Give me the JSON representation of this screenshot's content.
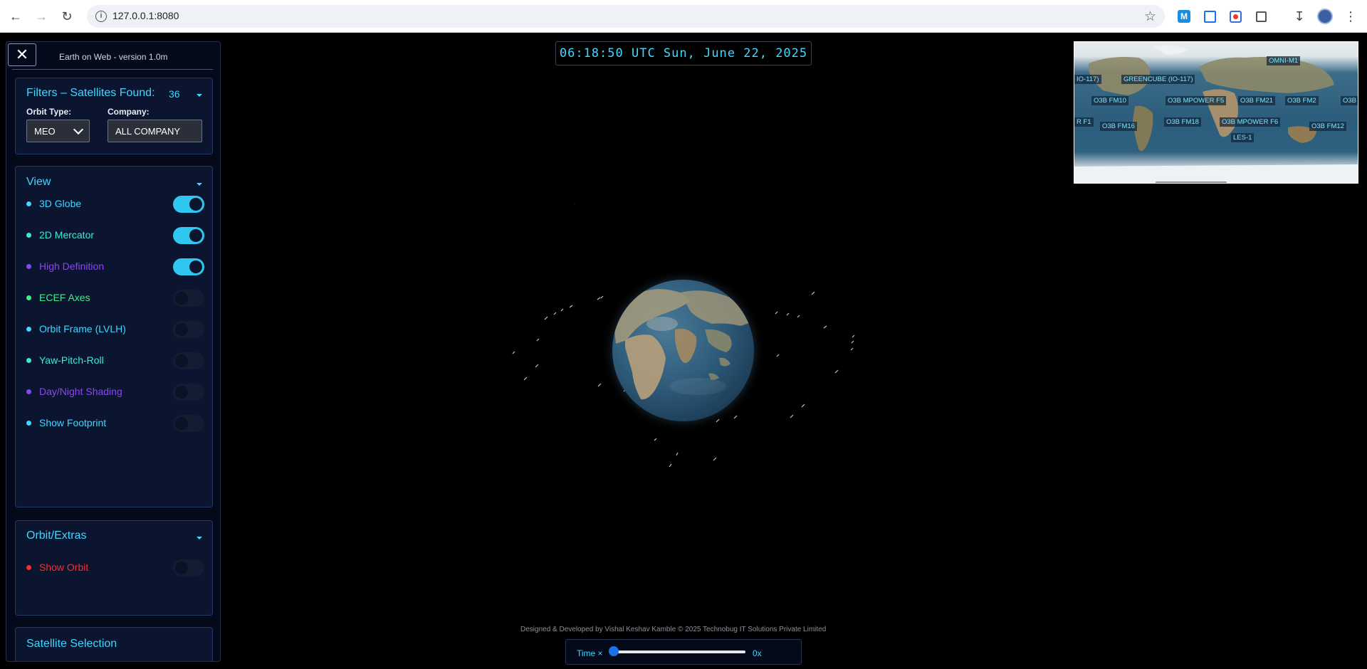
{
  "browser": {
    "url": "127.0.0.1:8080"
  },
  "app": {
    "version_label": "Earth on Web - version 1.0m",
    "clock": "06:18:50 UTC Sun, June 22, 2025",
    "credit": "Designed & Developed by Vishal Keshav Kamble   © 2025 Technobug IT Solutions Private Limited",
    "time_label": "Time ×",
    "time_value": "0x",
    "time_speed_fraction": 0
  },
  "filters": {
    "title": "Filters – Satellites Found:",
    "count": "36",
    "orbit_type_label": "Orbit Type:",
    "orbit_type_value": "MEO",
    "company_label": "Company:",
    "company_value": "ALL COMPANY"
  },
  "view": {
    "title": "View",
    "items": [
      {
        "label": "3D Globe",
        "on": true,
        "color": "#3fd6ff"
      },
      {
        "label": "2D Mercator",
        "on": true,
        "color": "#3fe9d8"
      },
      {
        "label": "High Definition",
        "on": true,
        "color": "#8a46f0"
      },
      {
        "label": "ECEF Axes",
        "on": false,
        "color": "#3ff08a"
      },
      {
        "label": "Orbit Frame (LVLH)",
        "on": false,
        "color": "#3fd6ff"
      },
      {
        "label": "Yaw-Pitch-Roll",
        "on": false,
        "color": "#3fe9d8"
      },
      {
        "label": "Day/Night Shading",
        "on": false,
        "color": "#8a46f0"
      },
      {
        "label": "Show Footprint",
        "on": false,
        "color": "#3fd6ff"
      }
    ]
  },
  "orbit_extras": {
    "title": "Orbit/Extras",
    "items": [
      {
        "label": "Show Orbit",
        "on": false,
        "color": "#ff2b2b"
      }
    ]
  },
  "satellite_selection": {
    "title": "Satellite Selection"
  },
  "minimap": {
    "labels": [
      "OMNI-M1",
      "IO-117)",
      "GREENCUBE (IO-117)",
      "O3B FM10",
      "O3B MPOWER F5",
      "O3B FM21",
      "O3B FM2",
      "O3B",
      "R F1",
      "O3B FM16",
      "O3B FM18",
      "O3B MPOWER F6",
      "O3B FM12",
      "LES-1"
    ]
  }
}
